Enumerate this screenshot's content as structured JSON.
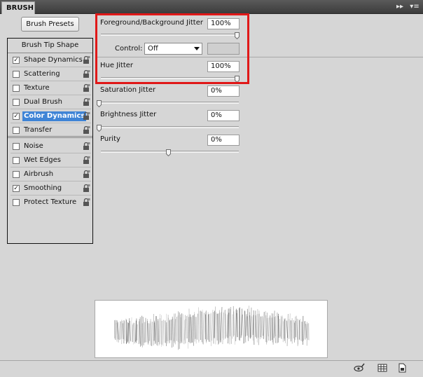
{
  "panel": {
    "tab_title": "BRUSH",
    "collapse_glyph": "▸▸",
    "menu_glyph": "▾≡"
  },
  "presets_button": "Brush Presets",
  "options": {
    "tip_shape": "Brush Tip Shape",
    "items": [
      {
        "label": "Shape Dynamics",
        "checked": true,
        "check": "✓"
      },
      {
        "label": "Scattering",
        "checked": false,
        "check": ""
      },
      {
        "label": "Texture",
        "checked": false,
        "check": ""
      },
      {
        "label": "Dual Brush",
        "checked": false,
        "check": ""
      },
      {
        "label": "Color Dynamics",
        "checked": true,
        "check": "✓",
        "selected": true
      },
      {
        "label": "Transfer",
        "checked": false,
        "check": ""
      },
      {
        "label": "Noise",
        "checked": false,
        "check": ""
      },
      {
        "label": "Wet Edges",
        "checked": false,
        "check": ""
      },
      {
        "label": "Airbrush",
        "checked": false,
        "check": ""
      },
      {
        "label": "Smoothing",
        "checked": true,
        "check": "✓"
      },
      {
        "label": "Protect Texture",
        "checked": false,
        "check": ""
      }
    ]
  },
  "settings": {
    "fg_bg_jitter": {
      "label": "Foreground/Background Jitter",
      "value": "100%",
      "level": 1.0
    },
    "control": {
      "label": "Control:",
      "value": "Off"
    },
    "hue_jitter": {
      "label": "Hue Jitter",
      "value": "100%",
      "level": 1.0
    },
    "saturation_jitter": {
      "label": "Saturation Jitter",
      "value": "0%",
      "level": 0.0
    },
    "brightness_jitter": {
      "label": "Brightness Jitter",
      "value": "0%",
      "level": 0.0
    },
    "purity": {
      "label": "Purity",
      "value": "0%",
      "level": 0.5
    }
  },
  "colors": {
    "highlight": "#e01818",
    "selection": "#3f84d6",
    "panel_bg": "#d6d6d6"
  },
  "bottom_icons": [
    "eye-brush-icon",
    "grid-icon",
    "new-preset-icon"
  ]
}
